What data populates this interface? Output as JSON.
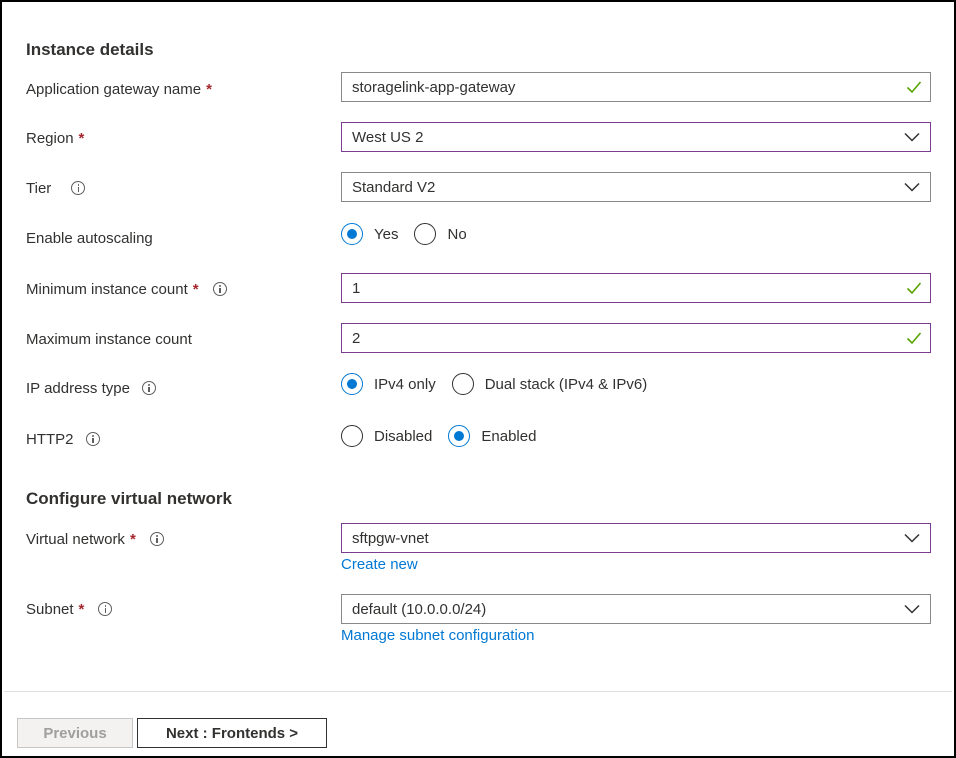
{
  "sections": {
    "instance_title": "Instance details",
    "vnet_title": "Configure virtual network"
  },
  "fields": {
    "gateway_name": {
      "label": "Application gateway name",
      "required": "*",
      "value": "storagelink-app-gateway"
    },
    "region": {
      "label": "Region",
      "required": "*",
      "value": "West US 2"
    },
    "tier": {
      "label": "Tier",
      "value": "Standard V2"
    },
    "autoscaling": {
      "label": "Enable autoscaling",
      "options": [
        "Yes",
        "No"
      ],
      "selected": "Yes"
    },
    "min_count": {
      "label": "Minimum instance count",
      "required": "*",
      "value": "1"
    },
    "max_count": {
      "label": "Maximum instance count",
      "value": "2"
    },
    "ip_type": {
      "label": "IP address type",
      "options": [
        "IPv4 only",
        "Dual stack (IPv4 & IPv6)"
      ],
      "selected": "IPv4 only"
    },
    "http2": {
      "label": "HTTP2",
      "options": [
        "Disabled",
        "Enabled"
      ],
      "selected": "Enabled"
    },
    "vnet": {
      "label": "Virtual network",
      "required": "*",
      "value": "sftpgw-vnet",
      "link": "Create new"
    },
    "subnet": {
      "label": "Subnet",
      "required": "*",
      "value": "default (10.0.0.0/24)",
      "link": "Manage subnet configuration"
    }
  },
  "buttons": {
    "previous": "Previous",
    "next": "Next : Frontends >"
  },
  "colors": {
    "accent": "#0078d4",
    "required": "#a4262c",
    "valid_check": "#57a300",
    "focus_border": "#7a3d91"
  }
}
